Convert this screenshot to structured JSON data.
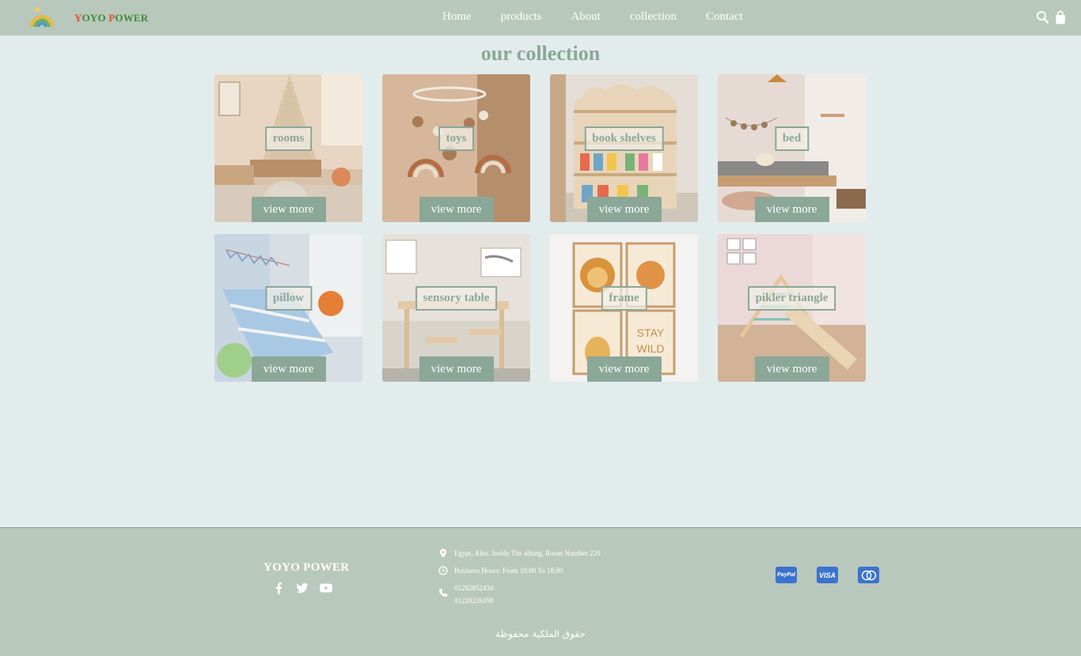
{
  "header": {
    "logo_icon": "rainbow-icon",
    "brand": [
      {
        "text": "Y",
        "color": "#e24b2a"
      },
      {
        "text": "OYO ",
        "color": "#3f8a3a"
      },
      {
        "text": "P",
        "color": "#e24b2a"
      },
      {
        "text": "OWER",
        "color": "#3f8a3a"
      }
    ],
    "nav": [
      "Home",
      "products",
      "About",
      "collection",
      "Contact"
    ],
    "icons": [
      "search-icon",
      "shopping-bag-icon"
    ]
  },
  "main": {
    "title": "our collection",
    "cards": [
      {
        "label": "rooms",
        "button": "view more"
      },
      {
        "label": "toys",
        "button": "view more"
      },
      {
        "label": "book shelves",
        "button": "view more"
      },
      {
        "label": "bed",
        "button": "view more"
      },
      {
        "label": "pillow",
        "button": "view more"
      },
      {
        "label": "sensory table",
        "button": "view more"
      },
      {
        "label": "frame",
        "button": "view more"
      },
      {
        "label": "pikler triangle",
        "button": "view more"
      }
    ]
  },
  "footer": {
    "brand": "YOYO POWER",
    "social": [
      "facebook-icon",
      "twitter-icon",
      "youtube-icon"
    ],
    "address": "Egypt, Alex, Inside The alburg, Room Number 220",
    "hours": "Business Hours: From 10:00 To 18:00",
    "phone1": "01282852434",
    "phone2": "01220226198",
    "payments": [
      "PayPal",
      "VISA",
      "mastercard-icon"
    ],
    "copyright": "حقوق الملكية محفوظة"
  },
  "colors": {
    "accent": "#8aa797",
    "header_bg": "#b8c8bc",
    "page_bg": "#e3ecec",
    "payment_badge": "#3b72ce"
  }
}
